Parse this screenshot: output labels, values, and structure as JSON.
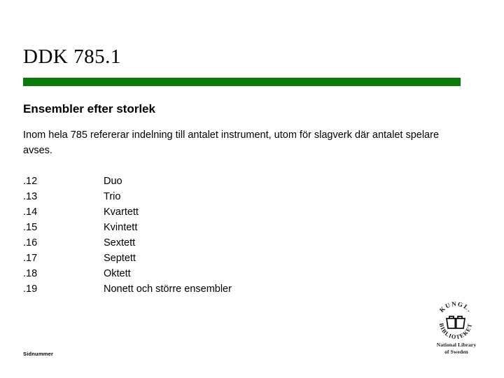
{
  "slide": {
    "title": "DDK 785.1",
    "accent_color": "#0a7a0a",
    "background_color": "#ffffff",
    "text_color": "#000000",
    "subheading": "Ensembler efter storlek",
    "intro_paragraph": "Inom hela 785 refererar indelning till antalet instrument, utom för slagverk där antalet spelare avses.",
    "entries": [
      {
        "code": ".12",
        "label": "Duo"
      },
      {
        "code": ".13",
        "label": "Trio"
      },
      {
        "code": ".14",
        "label": "Kvartett"
      },
      {
        "code": ".15",
        "label": "Kvintett"
      },
      {
        "code": ".16",
        "label": "Sextett"
      },
      {
        "code": ".17",
        "label": "Septett"
      },
      {
        "code": ".18",
        "label": "Oktett"
      },
      {
        "code": ".19",
        "label": "Nonett och större ensembler"
      }
    ],
    "footer": {
      "page_number_placeholder": "Sidnummer"
    },
    "logo": {
      "emblem_name": "kungliga-biblioteket-open-book-emblem",
      "ring_text_top": "KUNGL.",
      "ring_text_bottom": "BIBLIOTEKET",
      "caption_line_1": "National Library",
      "caption_line_2": "of Sweden"
    }
  }
}
